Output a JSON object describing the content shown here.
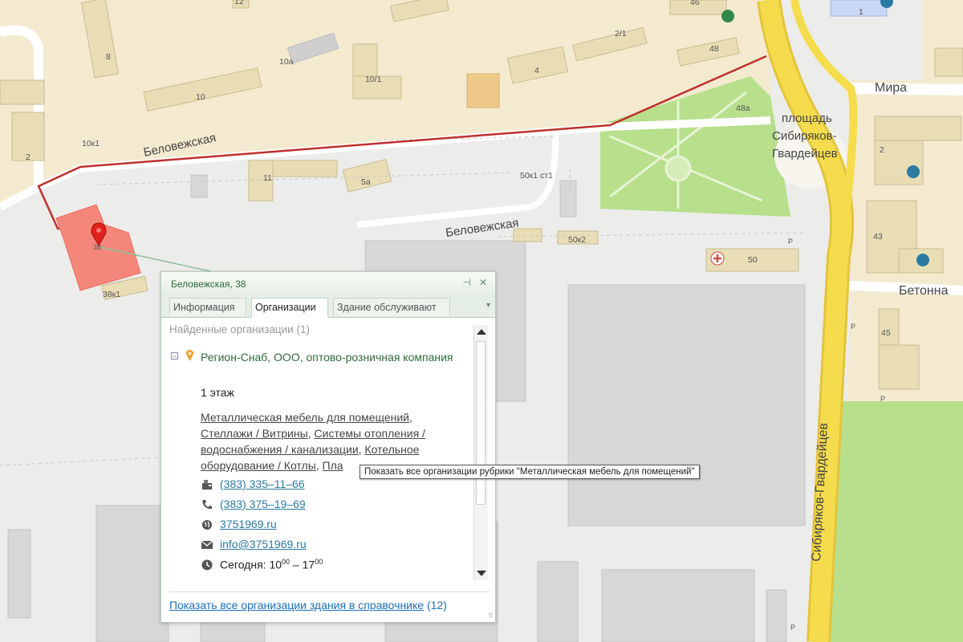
{
  "map": {
    "house_numbers": [
      "12",
      "8",
      "10а",
      "10/1",
      "4",
      "2/1",
      "46",
      "48",
      "1",
      "10",
      "10к1",
      "2",
      "11",
      "5а",
      "50к1 ст1",
      "50к2",
      "50",
      "38",
      "38к1",
      "48а",
      "2",
      "43",
      "45"
    ],
    "streets": {
      "belovezhskaya_top": "Беловежская",
      "belovezhskaya_mid": "Беловежская",
      "mira": "Мира",
      "square_line1": "площадь",
      "square_line2": "Сибиряков-",
      "square_line3": "Гвардейцев",
      "betonnaya": "Бетонна",
      "sibiryakov": "Сибиряков-Гвардейцев"
    },
    "parking_label": "P",
    "colors": {
      "residential": "#f3ead0",
      "industrial": "#d7d7d7",
      "park": "#b7df8c",
      "road_yellow": "#f5dc4c",
      "route": "#c0302b",
      "highlight": "#f5877a"
    }
  },
  "popup": {
    "title": "Беловежская, 38",
    "pin_label": "⊣",
    "close_label": "✕",
    "tab_menu": "▾",
    "tabs": [
      "Информация",
      "Организации",
      "Здание обслуживают"
    ],
    "active_tab": "Организации",
    "found_label": "Найденные организации (1)",
    "org": {
      "collapse": "−",
      "name": "Регион-Снаб, ООО, оптово-розничная компания",
      "floor": "1 этаж",
      "categories": [
        "Металлическая мебель для помещений",
        "Стеллажи / Витрины",
        "Системы отопления / водоснабжения / канализации",
        "Котельное оборудование / Котлы",
        "Пла"
      ],
      "fax": "(383) 335–11–66",
      "phone": "(383) 375–19–69",
      "website": "3751969.ru",
      "email": "info@3751969.ru",
      "hours_label": "Сегодня: ",
      "hours_from": "10",
      "hours_to": "17",
      "hours_sup": "00",
      "hours_dash": " – "
    },
    "footer_link": "Показать все организации здания в справочнике",
    "footer_count": "(12)",
    "grip": "⠿"
  },
  "tooltip": "Показать все организации рубрики \"Металлическая мебель для помещений\""
}
